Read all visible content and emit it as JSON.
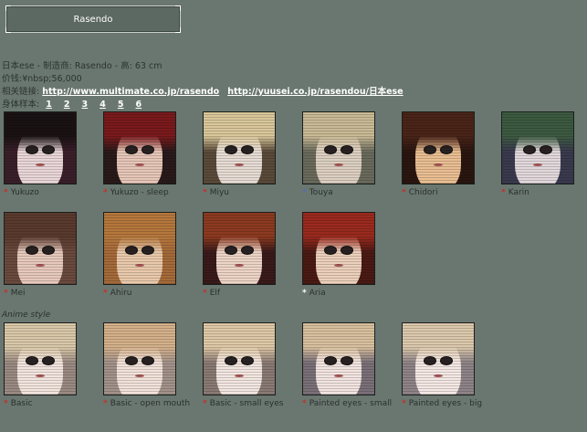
{
  "header": {
    "title": "Rasendo"
  },
  "info": {
    "line1": "日本ese  - 制造商: Rasendo - 高: 63 cm",
    "line2": "价钱:¥nbsp;56,000",
    "links_label": "相关链接:",
    "link1": "http://www.multimate.co.jp/rasendo",
    "link2": "http://yuusei.co.jp/rasendou/日本ese",
    "pages_label": "身体样本:",
    "pages": [
      "1",
      "2",
      "3",
      "4",
      "5",
      "6"
    ]
  },
  "section": {
    "anime_label": "Anime style"
  },
  "dolls": [
    {
      "name": "Yukuzo",
      "star_color": "#c0322c",
      "hair": "#1a1214",
      "skin": "#e9d6d8",
      "bg": "#3a1f2a"
    },
    {
      "name": "Yukuzo - sleep",
      "star_color": "#c0322c",
      "hair": "#7a1a1c",
      "skin": "#e6c6b8",
      "bg": "#2a1a1a"
    },
    {
      "name": "Miyu",
      "star_color": "#c0322c",
      "hair": "#d9c79a",
      "skin": "#e6dcd4",
      "bg": "#5a4a3a"
    },
    {
      "name": "Touya",
      "star_color": "#5a6bb0",
      "hair": "#c9ba95",
      "skin": "#ddd0c2",
      "bg": "#6a6a5c"
    },
    {
      "name": "Chidori",
      "star_color": "#c0322c",
      "hair": "#4a2418",
      "skin": "#e9be92",
      "bg": "#2a1610"
    },
    {
      "name": "Karin",
      "star_color": "#c0322c",
      "hair": "#3c5a40",
      "skin": "#e2d8dc",
      "bg": "#3a3a4e"
    },
    {
      "name": "Mei",
      "star_color": "#c0322c",
      "hair": "#5a3a2e",
      "skin": "#e7c9bc",
      "bg": "#6a4a3e"
    },
    {
      "name": "Ahiru",
      "star_color": "#c0322c",
      "hair": "#b5773c",
      "skin": "#e9c9ac",
      "bg": "#a56a3a"
    },
    {
      "name": "Elf",
      "star_color": "#c0322c",
      "hair": "#8c3a20",
      "skin": "#ecd4c6",
      "bg": "#3a1a1a"
    },
    {
      "name": "Aria",
      "star_color": "#ffffff",
      "hair": "#9a2a1e",
      "skin": "#ecd0bc",
      "bg": "#4a1a14"
    },
    {
      "name": "Basic",
      "star_color": "#c0322c",
      "hair": "#d9c8a8",
      "skin": "#f2e4de",
      "bg": "#9a8a82"
    },
    {
      "name": "Basic - open mouth",
      "star_color": "#c0322c",
      "hair": "#d4b08a",
      "skin": "#f2e2da",
      "bg": "#a2928a"
    },
    {
      "name": "Basic - small eyes",
      "star_color": "#c0322c",
      "hair": "#dfc8a6",
      "skin": "#f3e6e0",
      "bg": "#8a7a74"
    },
    {
      "name": "Painted eyes - small",
      "star_color": "#c0322c",
      "hair": "#d8c09e",
      "skin": "#f2e4e0",
      "bg": "#7a7078"
    },
    {
      "name": "Painted eyes - big",
      "star_color": "#c0322c",
      "hair": "#dcc8ac",
      "skin": "#f4e8e4",
      "bg": "#8e8488"
    }
  ]
}
